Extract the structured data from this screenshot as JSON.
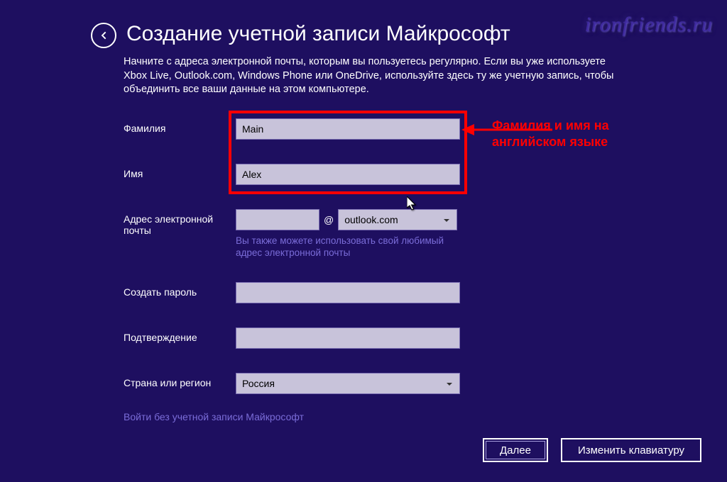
{
  "header": {
    "title": "Создание учетной записи Майкрософт",
    "description": "Начните с адреса электронной почты, которым вы пользуетесь регулярно. Если вы уже используете Xbox Live, Outlook.com, Windows Phone или OneDrive, используйте здесь ту же учетную запись, чтобы объединить все ваши данные на этом компьютере."
  },
  "form": {
    "lastname_label": "Фамилия",
    "lastname_value": "Main",
    "firstname_label": "Имя",
    "firstname_value": "Alex",
    "email_label": "Адрес электронной почты",
    "email_value": "",
    "at_symbol": "@",
    "email_domain": "outlook.com",
    "email_hint": "Вы также можете использовать свой любимый адрес электронной почты",
    "password_label": "Создать пароль",
    "password_value": "",
    "confirm_label": "Подтверждение",
    "confirm_value": "",
    "country_label": "Страна или регион",
    "country_value": "Россия"
  },
  "links": {
    "signin_without": "Войти без учетной записи Майкрософт"
  },
  "buttons": {
    "next": "Далее",
    "change_keyboard": "Изменить клавиатуру"
  },
  "annotation": {
    "text": "Фамилия и имя на английском языке"
  },
  "watermark": "ironfriends.ru"
}
